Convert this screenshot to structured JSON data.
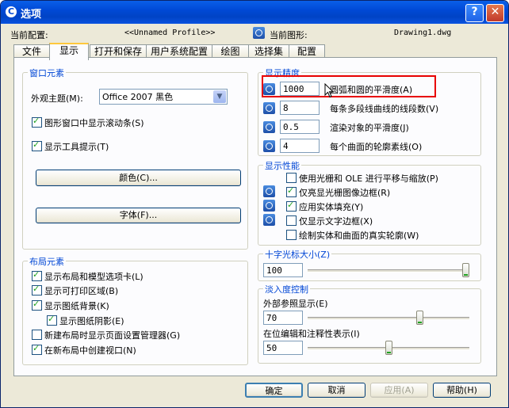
{
  "window": {
    "title": "选项"
  },
  "header": {
    "current_profile_label": "当前配置:",
    "current_profile_value": "<<Unnamed Profile>>",
    "current_drawing_label": "当前图形:",
    "current_drawing_value": "Drawing1.dwg"
  },
  "tabs": [
    "文件",
    "显示",
    "打开和保存",
    "用户系统配置",
    "绘图",
    "选择集",
    "配置"
  ],
  "window_elements": {
    "title": "窗口元素",
    "theme_label": "外观主题(M):",
    "theme_value": "Office 2007 黑色",
    "show_scrollbars": {
      "label": "图形窗口中显示滚动条(S)",
      "checked": true
    },
    "show_tooltips": {
      "label": "显示工具提示(T)",
      "checked": true
    },
    "colors_button": "颜色(C)...",
    "fonts_button": "字体(F)..."
  },
  "layout_elements": {
    "title": "布局元素",
    "items": [
      {
        "label": "显示布局和模型选项卡(L)",
        "checked": true
      },
      {
        "label": "显示可打印区域(B)",
        "checked": true
      },
      {
        "label": "显示图纸背景(K)",
        "checked": true
      },
      {
        "label": "显示图纸阴影(E)",
        "checked": true
      },
      {
        "label": "新建布局时显示页面设置管理器(G)",
        "checked": false
      },
      {
        "label": "在新布局中创建视口(N)",
        "checked": true
      }
    ]
  },
  "display_resolution": {
    "title": "显示精度",
    "items": [
      {
        "value": "1000",
        "label": "圆弧和圆的平滑度(A)"
      },
      {
        "value": "8",
        "label": "每条多段线曲线的线段数(V)"
      },
      {
        "value": "0.5",
        "label": "渲染对象的平滑度(J)"
      },
      {
        "value": "4",
        "label": "每个曲面的轮廓素线(O)"
      }
    ]
  },
  "display_performance": {
    "title": "显示性能",
    "items": [
      {
        "label": "使用光栅和 OLE 进行平移与缩放(P)",
        "checked": false
      },
      {
        "label": "仅亮显光栅图像边框(R)",
        "checked": true
      },
      {
        "label": "应用实体填充(Y)",
        "checked": true
      },
      {
        "label": "仅显示文字边框(X)",
        "checked": false
      },
      {
        "label": "绘制实体和曲面的真实轮廓(W)",
        "checked": false
      }
    ]
  },
  "crosshair": {
    "title": "十字光标大小(Z)",
    "value": "100",
    "slider_fraction": 1.0
  },
  "fade": {
    "title": "淡入度控制",
    "xref_label": "外部参照显示(E)",
    "xref_value": "70",
    "xref_fraction": 0.7,
    "inplace_label": "在位编辑和注释性表示(I)",
    "inplace_value": "50",
    "inplace_fraction": 0.5
  },
  "buttons": {
    "ok": "确定",
    "cancel": "取消",
    "apply": "应用(A)",
    "help": "帮助(H)"
  }
}
